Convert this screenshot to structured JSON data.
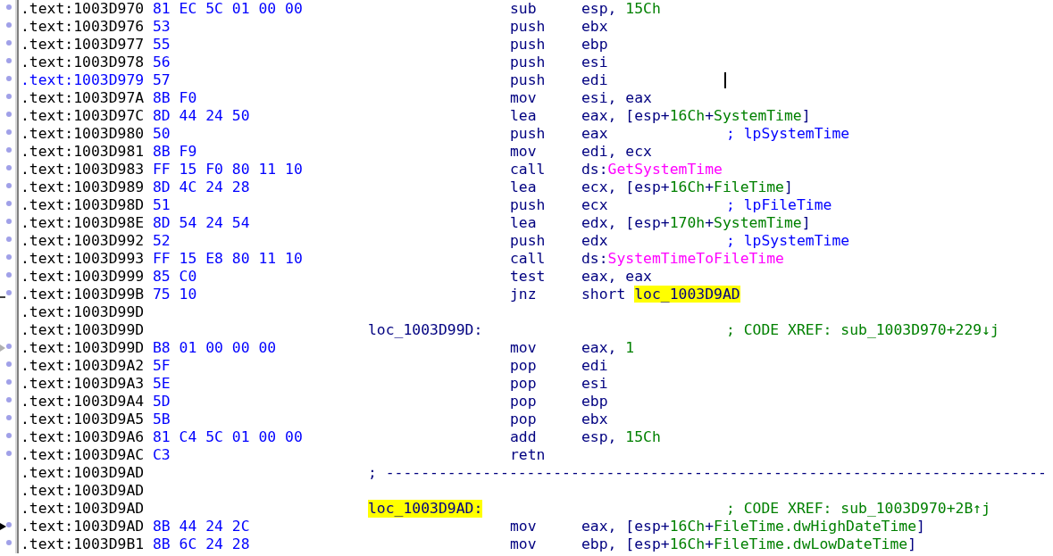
{
  "listing": {
    "lines": [
      {
        "kind": "instruction",
        "gutter": {
          "kind": "dot"
        },
        "current": false,
        "address": ".text:1003D970",
        "bytes": "81 EC 5C 01 00 00",
        "mnemonic": "sub",
        "operands": [
          {
            "text": "esp, ",
            "kind": "plain"
          },
          {
            "text": "15Ch",
            "kind": "number"
          }
        ]
      },
      {
        "kind": "instruction",
        "gutter": {
          "kind": "dot"
        },
        "current": false,
        "address": ".text:1003D976",
        "bytes": "53",
        "mnemonic": "push",
        "operands": [
          {
            "text": "ebx",
            "kind": "plain"
          }
        ]
      },
      {
        "kind": "instruction",
        "gutter": {
          "kind": "dot"
        },
        "current": false,
        "address": ".text:1003D977",
        "bytes": "55",
        "mnemonic": "push",
        "operands": [
          {
            "text": "ebp",
            "kind": "plain"
          }
        ]
      },
      {
        "kind": "instruction",
        "gutter": {
          "kind": "dot"
        },
        "current": false,
        "address": ".text:1003D978",
        "bytes": "56",
        "mnemonic": "push",
        "operands": [
          {
            "text": "esi",
            "kind": "plain"
          }
        ]
      },
      {
        "kind": "instruction",
        "gutter": {
          "kind": "dot"
        },
        "current": true,
        "address": ".text:1003D979",
        "bytes": "57",
        "mnemonic": "push",
        "operands": [
          {
            "text": "edi",
            "kind": "plain"
          }
        ]
      },
      {
        "kind": "instruction",
        "gutter": {
          "kind": "dot"
        },
        "current": false,
        "address": ".text:1003D97A",
        "bytes": "8B F0",
        "mnemonic": "mov",
        "operands": [
          {
            "text": "esi, eax",
            "kind": "plain"
          }
        ]
      },
      {
        "kind": "instruction",
        "gutter": {
          "kind": "dot"
        },
        "current": false,
        "address": ".text:1003D97C",
        "bytes": "8D 44 24 50",
        "mnemonic": "lea",
        "operands": [
          {
            "text": "eax, [esp+",
            "kind": "plain"
          },
          {
            "text": "16Ch",
            "kind": "number"
          },
          {
            "text": "+",
            "kind": "plain"
          },
          {
            "text": "SystemTime",
            "kind": "variable"
          },
          {
            "text": "]",
            "kind": "plain"
          }
        ]
      },
      {
        "kind": "instruction",
        "gutter": {
          "kind": "dot"
        },
        "current": false,
        "address": ".text:1003D980",
        "bytes": "50",
        "mnemonic": "push",
        "operands": [
          {
            "text": "eax",
            "kind": "plain"
          }
        ],
        "comment": {
          "text": "; lpSystemTime",
          "kind": "auto"
        }
      },
      {
        "kind": "instruction",
        "gutter": {
          "kind": "dot"
        },
        "current": false,
        "address": ".text:1003D981",
        "bytes": "8B F9",
        "mnemonic": "mov",
        "operands": [
          {
            "text": "edi, ecx",
            "kind": "plain"
          }
        ]
      },
      {
        "kind": "instruction",
        "gutter": {
          "kind": "dot"
        },
        "current": false,
        "address": ".text:1003D983",
        "bytes": "FF 15 F0 80 11 10",
        "mnemonic": "call",
        "operands": [
          {
            "text": "ds:",
            "kind": "plain"
          },
          {
            "text": "GetSystemTime",
            "kind": "import"
          }
        ]
      },
      {
        "kind": "instruction",
        "gutter": {
          "kind": "dot"
        },
        "current": false,
        "address": ".text:1003D989",
        "bytes": "8D 4C 24 28",
        "mnemonic": "lea",
        "operands": [
          {
            "text": "ecx, [esp+",
            "kind": "plain"
          },
          {
            "text": "16Ch",
            "kind": "number"
          },
          {
            "text": "+",
            "kind": "plain"
          },
          {
            "text": "FileTime",
            "kind": "variable"
          },
          {
            "text": "]",
            "kind": "plain"
          }
        ]
      },
      {
        "kind": "instruction",
        "gutter": {
          "kind": "dot"
        },
        "current": false,
        "address": ".text:1003D98D",
        "bytes": "51",
        "mnemonic": "push",
        "operands": [
          {
            "text": "ecx",
            "kind": "plain"
          }
        ],
        "comment": {
          "text": "; lpFileTime",
          "kind": "auto"
        }
      },
      {
        "kind": "instruction",
        "gutter": {
          "kind": "dot"
        },
        "current": false,
        "address": ".text:1003D98E",
        "bytes": "8D 54 24 54",
        "mnemonic": "lea",
        "operands": [
          {
            "text": "edx, [esp+",
            "kind": "plain"
          },
          {
            "text": "170h",
            "kind": "number"
          },
          {
            "text": "+",
            "kind": "plain"
          },
          {
            "text": "SystemTime",
            "kind": "variable"
          },
          {
            "text": "]",
            "kind": "plain"
          }
        ]
      },
      {
        "kind": "instruction",
        "gutter": {
          "kind": "dot"
        },
        "current": false,
        "address": ".text:1003D992",
        "bytes": "52",
        "mnemonic": "push",
        "operands": [
          {
            "text": "edx",
            "kind": "plain"
          }
        ],
        "comment": {
          "text": "; lpSystemTime",
          "kind": "auto"
        }
      },
      {
        "kind": "instruction",
        "gutter": {
          "kind": "dot"
        },
        "current": false,
        "address": ".text:1003D993",
        "bytes": "FF 15 E8 80 11 10",
        "mnemonic": "call",
        "operands": [
          {
            "text": "ds:",
            "kind": "plain"
          },
          {
            "text": "SystemTimeToFileTime",
            "kind": "import"
          }
        ]
      },
      {
        "kind": "instruction",
        "gutter": {
          "kind": "dot"
        },
        "current": false,
        "address": ".text:1003D999",
        "bytes": "85 C0",
        "mnemonic": "test",
        "operands": [
          {
            "text": "eax, eax",
            "kind": "plain"
          }
        ]
      },
      {
        "kind": "instruction",
        "gutter": {
          "kind": "branch"
        },
        "current": false,
        "address": ".text:1003D99B",
        "bytes": "75 10",
        "mnemonic": "jnz",
        "operands": [
          {
            "text": "short ",
            "kind": "plain"
          },
          {
            "text": "loc_1003D9AD",
            "kind": "highlight"
          }
        ]
      },
      {
        "kind": "blank",
        "gutter": {
          "kind": "none"
        },
        "current": false,
        "address": ".text:1003D99D"
      },
      {
        "kind": "label",
        "gutter": {
          "kind": "none"
        },
        "current": false,
        "address": ".text:1003D99D",
        "label": {
          "text": "loc_1003D99D:",
          "highlighted": false
        },
        "comment": {
          "text": "; CODE XREF: sub_1003D970+229↓j",
          "kind": "xref"
        }
      },
      {
        "kind": "instruction",
        "gutter": {
          "kind": "xref"
        },
        "current": false,
        "address": ".text:1003D99D",
        "bytes": "B8 01 00 00 00",
        "mnemonic": "mov",
        "operands": [
          {
            "text": "eax, ",
            "kind": "plain"
          },
          {
            "text": "1",
            "kind": "number"
          }
        ]
      },
      {
        "kind": "instruction",
        "gutter": {
          "kind": "dot"
        },
        "current": false,
        "address": ".text:1003D9A2",
        "bytes": "5F",
        "mnemonic": "pop",
        "operands": [
          {
            "text": "edi",
            "kind": "plain"
          }
        ]
      },
      {
        "kind": "instruction",
        "gutter": {
          "kind": "dot"
        },
        "current": false,
        "address": ".text:1003D9A3",
        "bytes": "5E",
        "mnemonic": "pop",
        "operands": [
          {
            "text": "esi",
            "kind": "plain"
          }
        ]
      },
      {
        "kind": "instruction",
        "gutter": {
          "kind": "dot"
        },
        "current": false,
        "address": ".text:1003D9A4",
        "bytes": "5D",
        "mnemonic": "pop",
        "operands": [
          {
            "text": "ebp",
            "kind": "plain"
          }
        ]
      },
      {
        "kind": "instruction",
        "gutter": {
          "kind": "dot"
        },
        "current": false,
        "address": ".text:1003D9A5",
        "bytes": "5B",
        "mnemonic": "pop",
        "operands": [
          {
            "text": "ebx",
            "kind": "plain"
          }
        ]
      },
      {
        "kind": "instruction",
        "gutter": {
          "kind": "dot"
        },
        "current": false,
        "address": ".text:1003D9A6",
        "bytes": "81 C4 5C 01 00 00",
        "mnemonic": "add",
        "operands": [
          {
            "text": "esp, ",
            "kind": "plain"
          },
          {
            "text": "15Ch",
            "kind": "number"
          }
        ]
      },
      {
        "kind": "instruction",
        "gutter": {
          "kind": "dot"
        },
        "current": false,
        "address": ".text:1003D9AC",
        "bytes": "C3",
        "mnemonic": "retn"
      },
      {
        "kind": "separator",
        "gutter": {
          "kind": "none"
        },
        "current": false,
        "address": ".text:1003D9AD",
        "text": "; ---------------------------------------------------------------------------"
      },
      {
        "kind": "blank",
        "gutter": {
          "kind": "none"
        },
        "current": false,
        "address": ".text:1003D9AD"
      },
      {
        "kind": "label",
        "gutter": {
          "kind": "none"
        },
        "current": false,
        "address": ".text:1003D9AD",
        "label": {
          "text": "loc_1003D9AD:",
          "highlighted": true
        },
        "comment": {
          "text": "; CODE XREF: sub_1003D970+2B↑j",
          "kind": "xref"
        }
      },
      {
        "kind": "instruction",
        "gutter": {
          "kind": "current"
        },
        "current": false,
        "address": ".text:1003D9AD",
        "bytes": "8B 44 24 2C",
        "mnemonic": "mov",
        "operands": [
          {
            "text": "eax, [esp+",
            "kind": "plain"
          },
          {
            "text": "16Ch",
            "kind": "number"
          },
          {
            "text": "+",
            "kind": "plain"
          },
          {
            "text": "FileTime.dwHighDateTime",
            "kind": "variable"
          },
          {
            "text": "]",
            "kind": "plain"
          }
        ]
      },
      {
        "kind": "instruction",
        "gutter": {
          "kind": "dot"
        },
        "current": false,
        "address": ".text:1003D9B1",
        "bytes": "8B 6C 24 28",
        "mnemonic": "mov",
        "operands": [
          {
            "text": "ebp, [esp+",
            "kind": "plain"
          },
          {
            "text": "16Ch",
            "kind": "number"
          },
          {
            "text": "+",
            "kind": "plain"
          },
          {
            "text": "FileTime.dwLowDateTime",
            "kind": "variable"
          },
          {
            "text": "]",
            "kind": "plain"
          }
        ]
      }
    ]
  }
}
